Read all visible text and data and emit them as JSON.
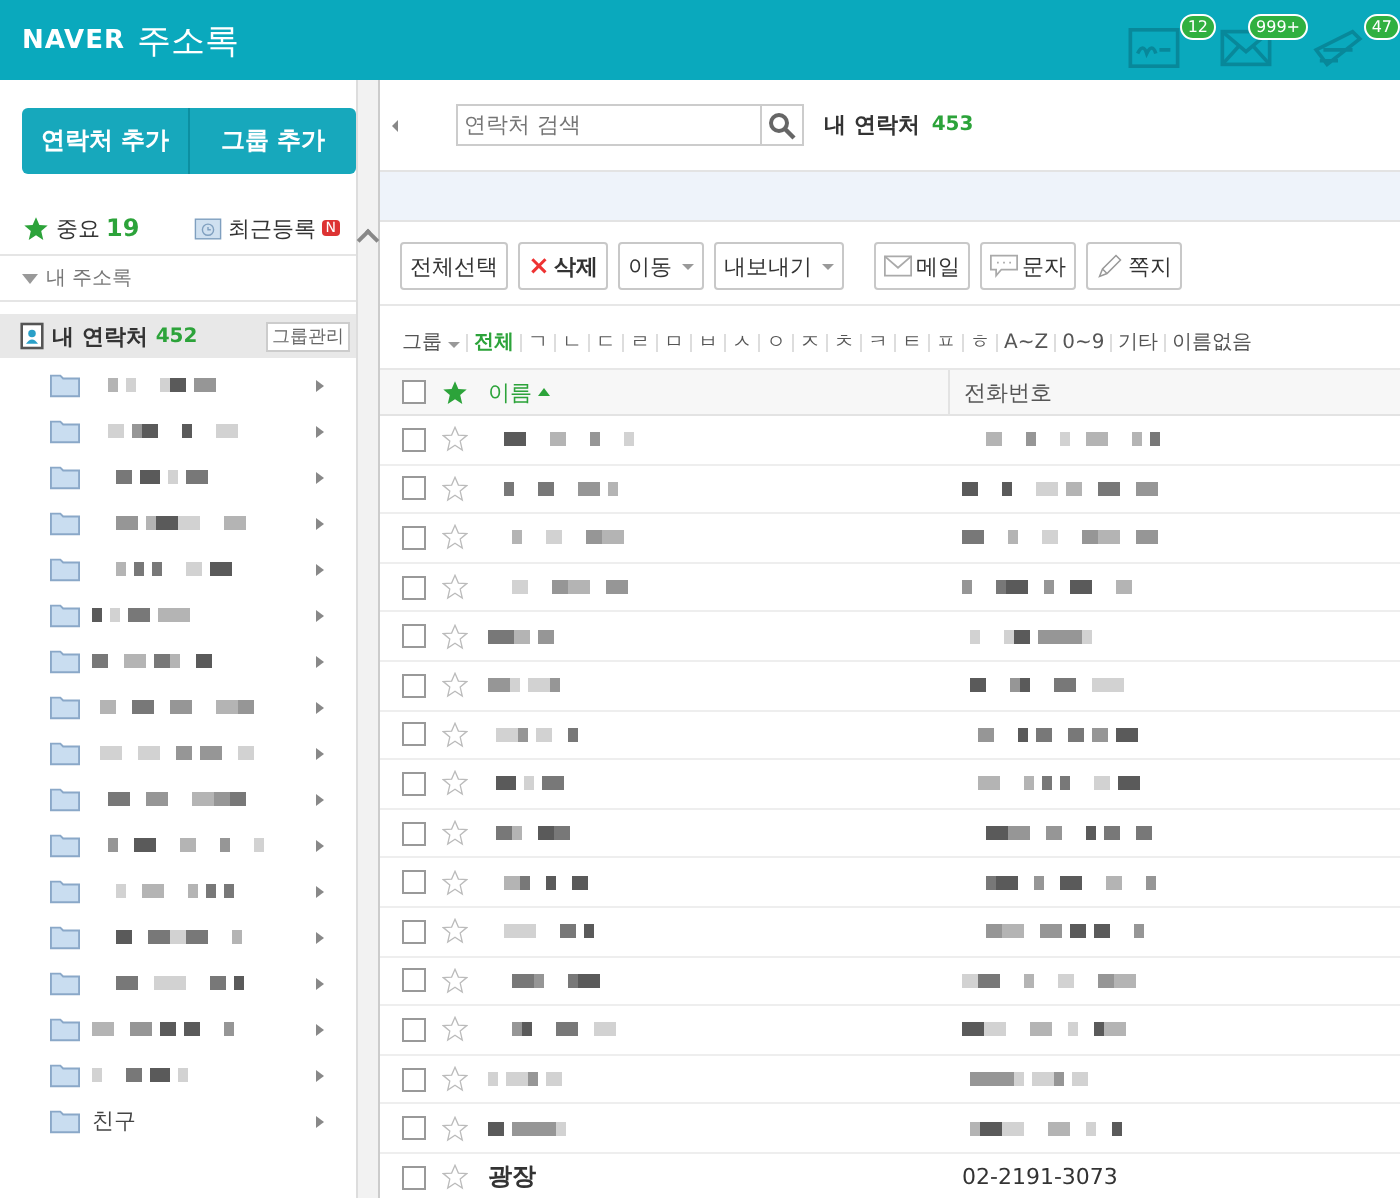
{
  "header": {
    "logo": "NAVER",
    "title": "주소록",
    "notifications": [
      {
        "kind": "me",
        "badge": "12"
      },
      {
        "kind": "mail",
        "badge": "999+"
      },
      {
        "kind": "note",
        "badge": "47"
      }
    ]
  },
  "sidebar": {
    "buttons": [
      "연락처 추가",
      "그룹 추가"
    ],
    "important": {
      "label": "중요",
      "count": "19"
    },
    "recent": {
      "label": "최근등록",
      "badge": "N"
    },
    "section": {
      "label": "내 주소록",
      "expanded": true
    },
    "my_contacts": {
      "label": "내 연락처",
      "count": "452",
      "manage": "그룹관리",
      "selected": true
    },
    "groups": [
      {
        "redacted": true
      },
      {
        "redacted": true
      },
      {
        "redacted": true
      },
      {
        "redacted": true
      },
      {
        "redacted": true
      },
      {
        "redacted": true
      },
      {
        "redacted": true
      },
      {
        "redacted": true
      },
      {
        "redacted": true
      },
      {
        "redacted": true
      },
      {
        "redacted": true
      },
      {
        "redacted": true
      },
      {
        "redacted": true
      },
      {
        "redacted": true
      },
      {
        "redacted": true
      },
      {
        "redacted": true
      },
      {
        "redacted": false,
        "name": "친구"
      }
    ]
  },
  "search": {
    "placeholder": "연락처 검색"
  },
  "heading": {
    "label": "내 연락처",
    "count": "453"
  },
  "toolbar": [
    {
      "kind": "plain",
      "label": "전체선택"
    },
    {
      "kind": "delete",
      "icon": "×",
      "label": "삭제"
    },
    {
      "kind": "dropdown",
      "label": "이동"
    },
    {
      "kind": "dropdown",
      "label": "내보내기"
    },
    {
      "kind": "mail",
      "label": "메일"
    },
    {
      "kind": "sms",
      "label": "문자"
    },
    {
      "kind": "note",
      "label": "쪽지"
    }
  ],
  "filter": {
    "group": "그룹",
    "letters": [
      {
        "label": "전체",
        "selected": true
      },
      {
        "label": "ㄱ",
        "selected": false
      },
      {
        "label": "ㄴ",
        "selected": false
      },
      {
        "label": "ㄷ",
        "selected": false
      },
      {
        "label": "ㄹ",
        "selected": false
      },
      {
        "label": "ㅁ",
        "selected": false
      },
      {
        "label": "ㅂ",
        "selected": false
      },
      {
        "label": "ㅅ",
        "selected": false
      },
      {
        "label": "ㅇ",
        "selected": false
      },
      {
        "label": "ㅈ",
        "selected": false
      },
      {
        "label": "ㅊ",
        "selected": false
      },
      {
        "label": "ㅋ",
        "selected": false
      },
      {
        "label": "ㅌ",
        "selected": false
      },
      {
        "label": "ㅍ",
        "selected": false
      },
      {
        "label": "ㅎ",
        "selected": false
      },
      {
        "label": "A~Z",
        "selected": false
      },
      {
        "label": "0~9",
        "selected": false
      },
      {
        "label": "기타",
        "selected": false
      },
      {
        "label": "이름없음",
        "selected": false
      }
    ]
  },
  "table": {
    "select_all_checked": false,
    "columns": [
      {
        "label": "이름",
        "sorted": true
      },
      {
        "label": "전화번호",
        "sorted": false
      }
    ],
    "rows": [
      {
        "redacted": true,
        "checked": false,
        "starred": false
      },
      {
        "redacted": true,
        "checked": false,
        "starred": false
      },
      {
        "redacted": true,
        "checked": false,
        "starred": false
      },
      {
        "redacted": true,
        "checked": false,
        "starred": false
      },
      {
        "redacted": true,
        "checked": false,
        "starred": false
      },
      {
        "redacted": true,
        "checked": false,
        "starred": false
      },
      {
        "redacted": true,
        "checked": false,
        "starred": false
      },
      {
        "redacted": true,
        "checked": false,
        "starred": false
      },
      {
        "redacted": true,
        "checked": false,
        "starred": false
      },
      {
        "redacted": true,
        "checked": false,
        "starred": false
      },
      {
        "redacted": true,
        "checked": false,
        "starred": false
      },
      {
        "redacted": true,
        "checked": false,
        "starred": false
      },
      {
        "redacted": true,
        "checked": false,
        "starred": false
      },
      {
        "redacted": true,
        "checked": false,
        "starred": false
      },
      {
        "redacted": true,
        "checked": false,
        "starred": false
      },
      {
        "redacted": false,
        "name": "광장",
        "phone": "02-2191-3073",
        "checked": false,
        "starred": false
      }
    ]
  }
}
